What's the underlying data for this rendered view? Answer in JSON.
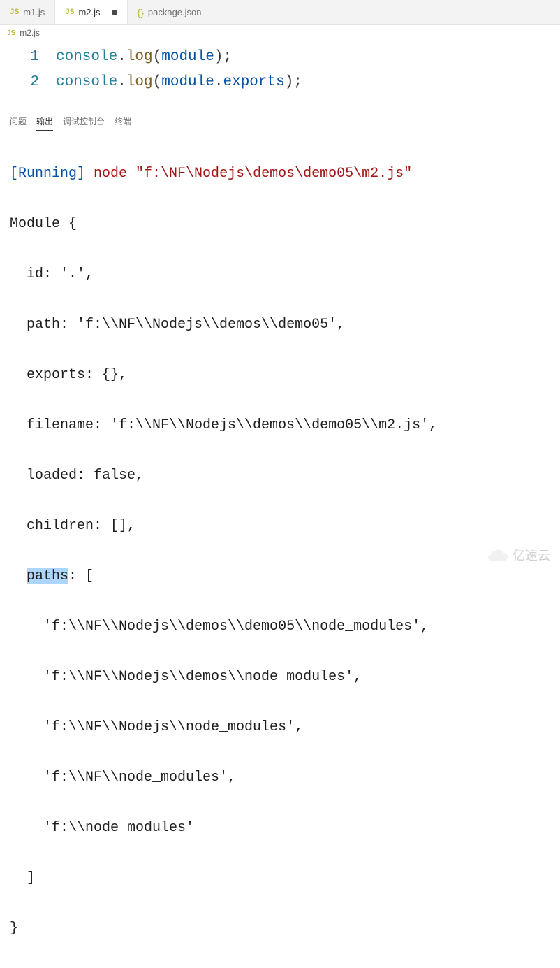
{
  "tabs": [
    {
      "icon": "JS",
      "label": "m1.js",
      "active": false,
      "dirty": false
    },
    {
      "icon": "JS",
      "label": "m2.js",
      "active": true,
      "dirty": true
    },
    {
      "icon": "{}",
      "label": "package.json",
      "active": false,
      "dirty": false
    }
  ],
  "breadcrumb": {
    "icon": "JS",
    "label": "m2.js"
  },
  "editor": {
    "lines": [
      {
        "num": "1",
        "tokens": [
          {
            "t": "console",
            "c": "obj"
          },
          {
            "t": ".",
            "c": "punc"
          },
          {
            "t": "log",
            "c": "fn"
          },
          {
            "t": "(",
            "c": "punc"
          },
          {
            "t": "module",
            "c": "prop"
          },
          {
            "t": ");",
            "c": "punc"
          }
        ]
      },
      {
        "num": "2",
        "tokens": [
          {
            "t": "console",
            "c": "obj"
          },
          {
            "t": ".",
            "c": "punc"
          },
          {
            "t": "log",
            "c": "fn"
          },
          {
            "t": "(",
            "c": "punc"
          },
          {
            "t": "module",
            "c": "prop"
          },
          {
            "t": ".",
            "c": "punc"
          },
          {
            "t": "exports",
            "c": "prop"
          },
          {
            "t": ");",
            "c": "punc"
          }
        ]
      }
    ]
  },
  "panelTabs": {
    "problems": "问题",
    "output": "输出",
    "debugConsole": "调试控制台",
    "terminal": "终端",
    "active": "output"
  },
  "output": {
    "runningLabel": "[Running]",
    "command": " node \"f:\\NF\\Nodejs\\demos\\demo05\\m2.js\"",
    "lines": [
      "Module {",
      "  id: '.',",
      "  path: 'f:\\\\NF\\\\Nodejs\\\\demos\\\\demo05',",
      "  exports: {},",
      "  filename: 'f:\\\\NF\\\\Nodejs\\\\demos\\\\demo05\\\\m2.js',",
      "  loaded: false,",
      "  children: [],",
      {
        "pre": "  ",
        "hl": "paths",
        "post": ": ["
      },
      "    'f:\\\\NF\\\\Nodejs\\\\demos\\\\demo05\\\\node_modules',",
      "    'f:\\\\NF\\\\Nodejs\\\\demos\\\\node_modules',",
      "    'f:\\\\NF\\\\Nodejs\\\\node_modules',",
      "    'f:\\\\NF\\\\node_modules',",
      "    'f:\\\\node_modules'",
      "  ]",
      "}"
    ]
  },
  "watermark": "亿速云"
}
